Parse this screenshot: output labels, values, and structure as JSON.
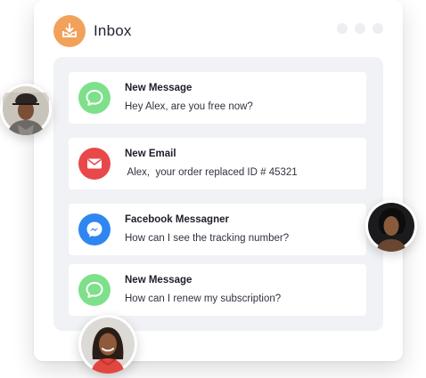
{
  "header": {
    "title": "Inbox",
    "icon": "inbox-download-icon",
    "icon_color": "#f2a15a"
  },
  "window_controls": [
    "dot",
    "dot",
    "dot"
  ],
  "messages": [
    {
      "title": "New Message",
      "body": "Hey Alex, are you free now?",
      "icon": "chat-bubble-icon",
      "icon_color": "#7ee08a"
    },
    {
      "title": "New Email",
      "body": " Alex,  your order replaced ID # 45321",
      "icon": "envelope-icon",
      "icon_color": "#e8484a"
    },
    {
      "title": "Facebook Messagner",
      "body": "How can I see the tracking number?",
      "icon": "messenger-icon",
      "icon_color": "#2f86f0"
    },
    {
      "title": "New Message",
      "body": "How can I renew my subscription?",
      "icon": "chat-bubble-icon",
      "icon_color": "#7ee08a"
    }
  ],
  "avatars": [
    "avatar-man-hat",
    "avatar-woman-dark",
    "avatar-woman-braids"
  ]
}
